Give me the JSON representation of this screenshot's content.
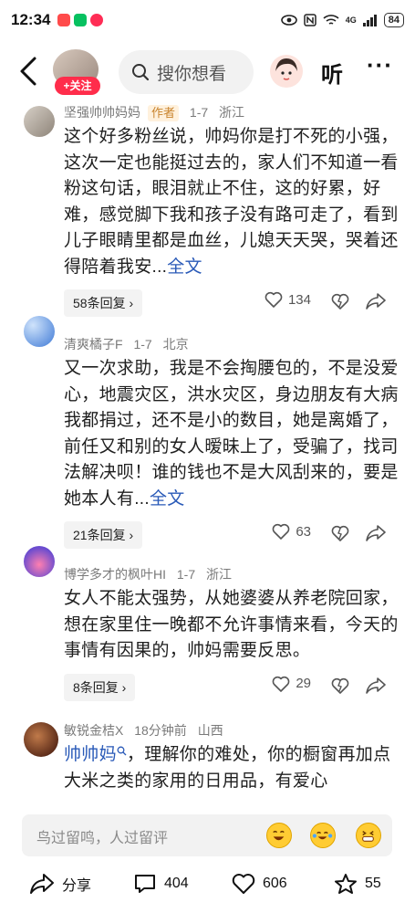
{
  "status_bar": {
    "time": "12:34",
    "battery": "84",
    "network": "4G",
    "app_colors": [
      "#ff4b4b",
      "#07c160",
      "#ff2d55"
    ]
  },
  "header": {
    "follow_label": "+关注",
    "search_placeholder": "搜你想看",
    "listen_label": "听",
    "more_label": "···"
  },
  "comments": [
    {
      "username": "坚强帅帅妈妈",
      "author_tag": "作者",
      "date": "1-7",
      "location": "浙江",
      "avatar_color": "#c9c0b8",
      "text": "这个好多粉丝说，帅妈你是打不死的小强，这次一定也能挺过去的，家人们不知道一看粉这句话，眼泪就止不住，这的好累，好难，感觉脚下我和孩子没有路可走了，看到儿子眼睛里都是血丝，儿媳天天哭，哭着还得陪着我安...",
      "more_label": "全文",
      "reply_label": "58条回复 ›",
      "likes": "134"
    },
    {
      "username": "清爽橘子F",
      "date": "1-7",
      "location": "北京",
      "avatar_color": "#5b8fd8",
      "text": "又一次求助，我是不会掏腰包的，不是没爱心，地震灾区，洪水灾区，身边朋友有大病我都捐过，还不是小的数目，她是离婚了，前任又和别的女人暧昧上了，受骗了，找司法解决呗！谁的钱也不是大风刮来的，要是她本人有...",
      "more_label": "全文",
      "reply_label": "21条回复 ›",
      "likes": "63"
    },
    {
      "username": "博学多才的枫叶HI",
      "date": "1-7",
      "location": "浙江",
      "avatar_color": "#6a4ccf",
      "text": "女人不能太强势，从她婆婆从养老院回家，想在家里住一晚都不允许事情来看，今天的事情有因果的，帅妈需要反思。",
      "reply_label": "8条回复 ›",
      "likes": "29"
    },
    {
      "username": "敏锐金桔X",
      "date": "18分钟前",
      "location": "山西",
      "avatar_color": "#8a4a2a",
      "mention": "帅帅妈",
      "text": "，理解你的难处，你的橱窗再加点大米之类的家用的日用品，有爱心"
    }
  ],
  "input_bar": {
    "placeholder": "鸟过留鸣，人过留评"
  },
  "bottom_bar": {
    "share_label": "分享",
    "comment_count": "404",
    "like_count": "606",
    "favorite_count": "55"
  }
}
